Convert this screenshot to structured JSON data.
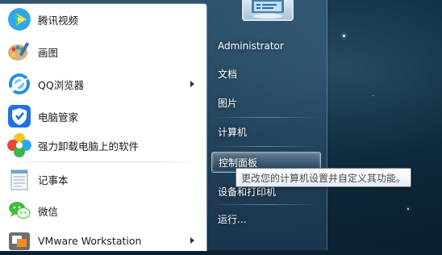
{
  "left_programs": [
    {
      "label": "腾讯视频",
      "icon": "tencent-video-icon",
      "has_submenu": false
    },
    {
      "label": "画图",
      "icon": "paint-icon",
      "has_submenu": false
    },
    {
      "label": "QQ浏览器",
      "icon": "qq-browser-icon",
      "has_submenu": true
    },
    {
      "label": "电脑管家",
      "icon": "pc-manager-shield-icon",
      "has_submenu": false
    },
    {
      "label": "强力卸载电脑上的软件",
      "icon": "uninstaller-icon",
      "has_submenu": false
    },
    {
      "label": "记事本",
      "icon": "notepad-icon",
      "has_submenu": false
    },
    {
      "label": "微信",
      "icon": "wechat-icon",
      "has_submenu": false
    },
    {
      "label": "VMware Workstation",
      "icon": "vmware-icon",
      "has_submenu": true
    }
  ],
  "right_links": {
    "user": "Administrator",
    "documents": "文档",
    "pictures": "图片",
    "computer": "计算机",
    "control_panel": "控制面板",
    "devices_printers": "设备和打印机",
    "run": "运行..."
  },
  "tooltip": {
    "text": "更改您的计算机设置并自定义其功能。"
  },
  "colors": {
    "tencent_video": "#20a0e8",
    "qq_browser": "#2a8fe0",
    "pc_manager": "#1a73e8",
    "wechat": "#3fbe3a",
    "vmware": "#6d6e71"
  }
}
